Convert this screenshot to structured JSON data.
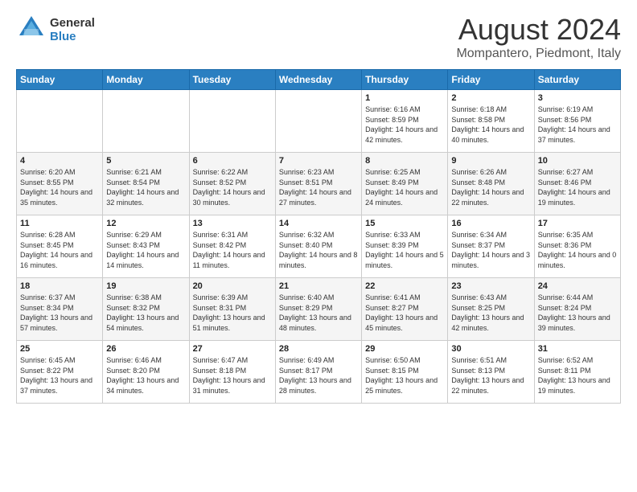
{
  "logo": {
    "general": "General",
    "blue": "Blue"
  },
  "title": "August 2024",
  "location": "Mompantero, Piedmont, Italy",
  "headers": [
    "Sunday",
    "Monday",
    "Tuesday",
    "Wednesday",
    "Thursday",
    "Friday",
    "Saturday"
  ],
  "weeks": [
    [
      {
        "day": "",
        "info": ""
      },
      {
        "day": "",
        "info": ""
      },
      {
        "day": "",
        "info": ""
      },
      {
        "day": "",
        "info": ""
      },
      {
        "day": "1",
        "info": "Sunrise: 6:16 AM\nSunset: 8:59 PM\nDaylight: 14 hours\nand 42 minutes."
      },
      {
        "day": "2",
        "info": "Sunrise: 6:18 AM\nSunset: 8:58 PM\nDaylight: 14 hours\nand 40 minutes."
      },
      {
        "day": "3",
        "info": "Sunrise: 6:19 AM\nSunset: 8:56 PM\nDaylight: 14 hours\nand 37 minutes."
      }
    ],
    [
      {
        "day": "4",
        "info": "Sunrise: 6:20 AM\nSunset: 8:55 PM\nDaylight: 14 hours\nand 35 minutes."
      },
      {
        "day": "5",
        "info": "Sunrise: 6:21 AM\nSunset: 8:54 PM\nDaylight: 14 hours\nand 32 minutes."
      },
      {
        "day": "6",
        "info": "Sunrise: 6:22 AM\nSunset: 8:52 PM\nDaylight: 14 hours\nand 30 minutes."
      },
      {
        "day": "7",
        "info": "Sunrise: 6:23 AM\nSunset: 8:51 PM\nDaylight: 14 hours\nand 27 minutes."
      },
      {
        "day": "8",
        "info": "Sunrise: 6:25 AM\nSunset: 8:49 PM\nDaylight: 14 hours\nand 24 minutes."
      },
      {
        "day": "9",
        "info": "Sunrise: 6:26 AM\nSunset: 8:48 PM\nDaylight: 14 hours\nand 22 minutes."
      },
      {
        "day": "10",
        "info": "Sunrise: 6:27 AM\nSunset: 8:46 PM\nDaylight: 14 hours\nand 19 minutes."
      }
    ],
    [
      {
        "day": "11",
        "info": "Sunrise: 6:28 AM\nSunset: 8:45 PM\nDaylight: 14 hours\nand 16 minutes."
      },
      {
        "day": "12",
        "info": "Sunrise: 6:29 AM\nSunset: 8:43 PM\nDaylight: 14 hours\nand 14 minutes."
      },
      {
        "day": "13",
        "info": "Sunrise: 6:31 AM\nSunset: 8:42 PM\nDaylight: 14 hours\nand 11 minutes."
      },
      {
        "day": "14",
        "info": "Sunrise: 6:32 AM\nSunset: 8:40 PM\nDaylight: 14 hours\nand 8 minutes."
      },
      {
        "day": "15",
        "info": "Sunrise: 6:33 AM\nSunset: 8:39 PM\nDaylight: 14 hours\nand 5 minutes."
      },
      {
        "day": "16",
        "info": "Sunrise: 6:34 AM\nSunset: 8:37 PM\nDaylight: 14 hours\nand 3 minutes."
      },
      {
        "day": "17",
        "info": "Sunrise: 6:35 AM\nSunset: 8:36 PM\nDaylight: 14 hours\nand 0 minutes."
      }
    ],
    [
      {
        "day": "18",
        "info": "Sunrise: 6:37 AM\nSunset: 8:34 PM\nDaylight: 13 hours\nand 57 minutes."
      },
      {
        "day": "19",
        "info": "Sunrise: 6:38 AM\nSunset: 8:32 PM\nDaylight: 13 hours\nand 54 minutes."
      },
      {
        "day": "20",
        "info": "Sunrise: 6:39 AM\nSunset: 8:31 PM\nDaylight: 13 hours\nand 51 minutes."
      },
      {
        "day": "21",
        "info": "Sunrise: 6:40 AM\nSunset: 8:29 PM\nDaylight: 13 hours\nand 48 minutes."
      },
      {
        "day": "22",
        "info": "Sunrise: 6:41 AM\nSunset: 8:27 PM\nDaylight: 13 hours\nand 45 minutes."
      },
      {
        "day": "23",
        "info": "Sunrise: 6:43 AM\nSunset: 8:25 PM\nDaylight: 13 hours\nand 42 minutes."
      },
      {
        "day": "24",
        "info": "Sunrise: 6:44 AM\nSunset: 8:24 PM\nDaylight: 13 hours\nand 39 minutes."
      }
    ],
    [
      {
        "day": "25",
        "info": "Sunrise: 6:45 AM\nSunset: 8:22 PM\nDaylight: 13 hours\nand 37 minutes."
      },
      {
        "day": "26",
        "info": "Sunrise: 6:46 AM\nSunset: 8:20 PM\nDaylight: 13 hours\nand 34 minutes."
      },
      {
        "day": "27",
        "info": "Sunrise: 6:47 AM\nSunset: 8:18 PM\nDaylight: 13 hours\nand 31 minutes."
      },
      {
        "day": "28",
        "info": "Sunrise: 6:49 AM\nSunset: 8:17 PM\nDaylight: 13 hours\nand 28 minutes."
      },
      {
        "day": "29",
        "info": "Sunrise: 6:50 AM\nSunset: 8:15 PM\nDaylight: 13 hours\nand 25 minutes."
      },
      {
        "day": "30",
        "info": "Sunrise: 6:51 AM\nSunset: 8:13 PM\nDaylight: 13 hours\nand 22 minutes."
      },
      {
        "day": "31",
        "info": "Sunrise: 6:52 AM\nSunset: 8:11 PM\nDaylight: 13 hours\nand 19 minutes."
      }
    ]
  ]
}
